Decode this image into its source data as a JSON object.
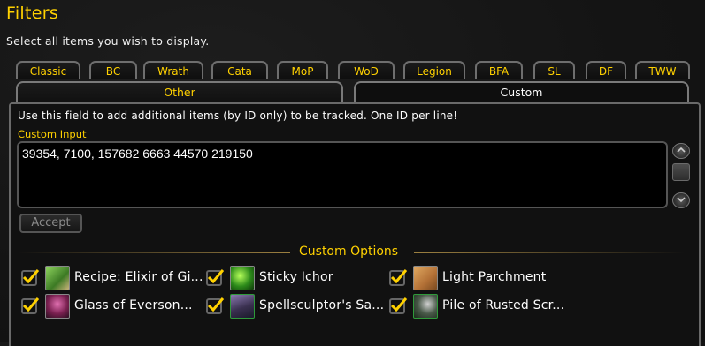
{
  "header": {
    "title": "Filters",
    "subtitle": "Select all items you wish to display."
  },
  "expansion_tabs": [
    "Classic",
    "BC",
    "Wrath",
    "Cata",
    "MoP",
    "WoD",
    "Legion",
    "BFA",
    "SL",
    "DF",
    "TWW"
  ],
  "sub_tabs": {
    "other": "Other",
    "custom": "Custom",
    "active": "Custom"
  },
  "custom": {
    "info": "Use this field to add additional items (by ID only) to be tracked.  One ID per line!",
    "input_label": "Custom Input",
    "input_value": "39354, 7100, 157682 6663 44570 219150",
    "accept_label": "Accept"
  },
  "options": {
    "title": "Custom Options",
    "items": [
      {
        "label": "Recipe: Elixir of Gi...",
        "checked": true,
        "icon": "recipe-scroll-icon",
        "color": "#6aa84f"
      },
      {
        "label": "Sticky Ichor",
        "checked": true,
        "icon": "green-ichor-icon",
        "color": "#3fae2a"
      },
      {
        "label": "Light Parchment",
        "checked": true,
        "icon": "parchment-icon",
        "color": "#c8914a"
      },
      {
        "label": "Glass of Everson...",
        "checked": true,
        "icon": "wine-glass-icon",
        "color": "#b04a8a"
      },
      {
        "label": "Spellsculptor's Sa...",
        "checked": true,
        "icon": "purple-sand-icon",
        "color": "#6a5a8a"
      },
      {
        "label": "Pile of Rusted Scr...",
        "checked": true,
        "icon": "rusted-scrap-icon",
        "color": "#4a6a4a"
      }
    ]
  },
  "colors": {
    "accent_gold": "#ffd100",
    "background": "#151515"
  }
}
